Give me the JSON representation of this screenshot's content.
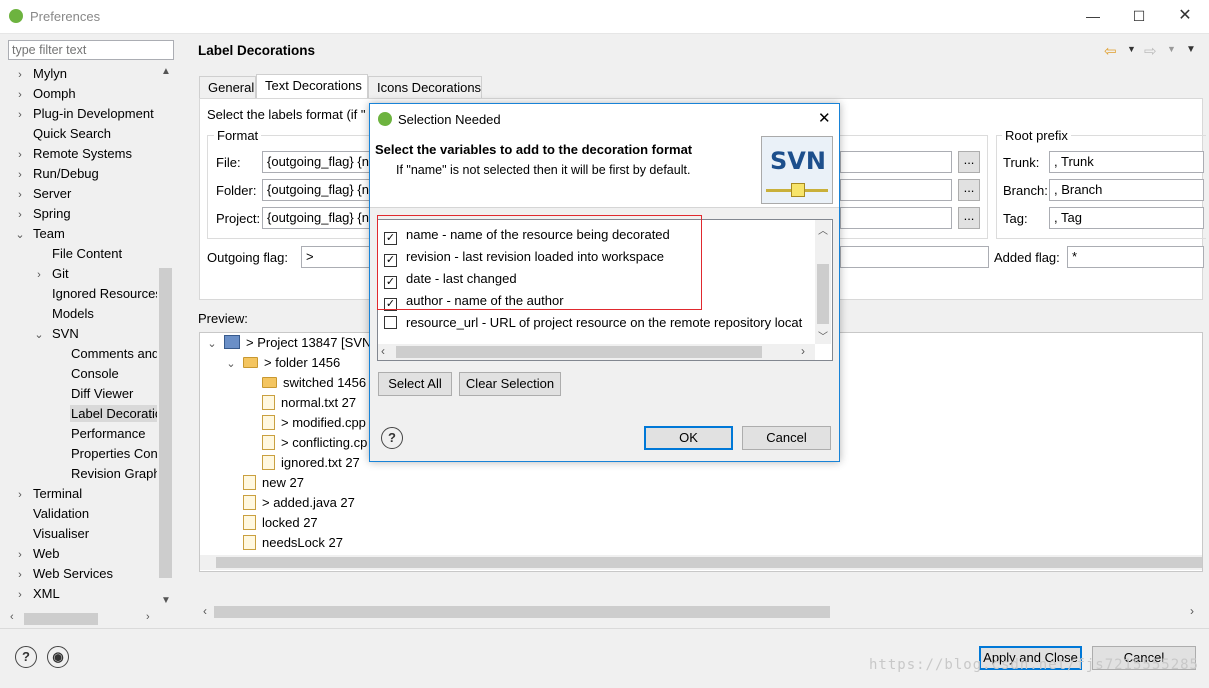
{
  "window": {
    "title": "Preferences",
    "controls": [
      "minimize",
      "maximize",
      "close"
    ]
  },
  "filter": {
    "placeholder": "type filter text"
  },
  "tree": [
    {
      "label": "Mylyn",
      "level": 0,
      "chev": "›"
    },
    {
      "label": "Oomph",
      "level": 0,
      "chev": "›"
    },
    {
      "label": "Plug-in Development",
      "level": 0,
      "chev": "›"
    },
    {
      "label": "Quick Search",
      "level": 0,
      "chev": ""
    },
    {
      "label": "Remote Systems",
      "level": 0,
      "chev": "›"
    },
    {
      "label": "Run/Debug",
      "level": 0,
      "chev": "›"
    },
    {
      "label": "Server",
      "level": 0,
      "chev": "›"
    },
    {
      "label": "Spring",
      "level": 0,
      "chev": "›"
    },
    {
      "label": "Team",
      "level": 0,
      "chev": "⌄"
    },
    {
      "label": "File Content",
      "level": 1,
      "chev": ""
    },
    {
      "label": "Git",
      "level": 1,
      "chev": "›"
    },
    {
      "label": "Ignored Resources",
      "level": 1,
      "chev": ""
    },
    {
      "label": "Models",
      "level": 1,
      "chev": ""
    },
    {
      "label": "SVN",
      "level": 1,
      "chev": "⌄"
    },
    {
      "label": "Comments and",
      "level": 2,
      "chev": ""
    },
    {
      "label": "Console",
      "level": 2,
      "chev": ""
    },
    {
      "label": "Diff Viewer",
      "level": 2,
      "chev": ""
    },
    {
      "label": "Label Decoratio",
      "level": 2,
      "chev": "",
      "selected": true
    },
    {
      "label": "Performance",
      "level": 2,
      "chev": ""
    },
    {
      "label": "Properties Con",
      "level": 2,
      "chev": ""
    },
    {
      "label": "Revision Graph",
      "level": 2,
      "chev": ""
    },
    {
      "label": "Terminal",
      "level": 0,
      "chev": "›"
    },
    {
      "label": "Validation",
      "level": 0,
      "chev": ""
    },
    {
      "label": "Visualiser",
      "level": 0,
      "chev": ""
    },
    {
      "label": "Web",
      "level": 0,
      "chev": "›"
    },
    {
      "label": "Web Services",
      "level": 0,
      "chev": "›"
    },
    {
      "label": "XML",
      "level": 0,
      "chev": "›"
    }
  ],
  "page": {
    "title": "Label Decorations"
  },
  "tabs": [
    "General",
    "Text Decorations",
    "Icons Decorations"
  ],
  "text_decorations": {
    "intro": "Select the labels format (if \"",
    "format_group": "Format",
    "file_label": "File:",
    "file_value": "{outgoing_flag} {n",
    "folder_label": "Folder:",
    "folder_value": "{outgoing_flag} {n",
    "project_label": "Project:",
    "project_value": "{outgoing_flag} {n",
    "dots": "...",
    "root_prefix_group": "Root prefix",
    "trunk_label": "Trunk:",
    "trunk_value": ", Trunk",
    "branch_label": "Branch:",
    "branch_value": ", Branch",
    "tag_label": "Tag:",
    "tag_value": ", Tag",
    "outgoing_label": "Outgoing flag:",
    "outgoing_value": ">",
    "added_label": "Added flag:",
    "added_value": "*"
  },
  "preview": {
    "label": "Preview:",
    "items": [
      {
        "text": "> Project 13847 [SVN",
        "icon": "project",
        "chev": "⌄",
        "indent": 0
      },
      {
        "text": "> folder 1456",
        "icon": "folder",
        "chev": "⌄",
        "indent": 1
      },
      {
        "text": "switched 1456",
        "icon": "folder",
        "chev": "",
        "indent": 2
      },
      {
        "text": "normal.txt 27",
        "icon": "file",
        "chev": "",
        "indent": 2
      },
      {
        "text": "> modified.cpp",
        "icon": "file",
        "chev": "",
        "indent": 2
      },
      {
        "text": "> conflicting.cp",
        "icon": "file",
        "chev": "",
        "indent": 2
      },
      {
        "text": "ignored.txt 27",
        "icon": "file",
        "chev": "",
        "indent": 2
      },
      {
        "text": "new 27",
        "icon": "file",
        "chev": "",
        "indent": 1
      },
      {
        "text": "> added.java 27",
        "icon": "file",
        "chev": "",
        "indent": 1
      },
      {
        "text": "locked 27",
        "icon": "file",
        "chev": "",
        "indent": 1
      },
      {
        "text": "needsLock 27",
        "icon": "file",
        "chev": "",
        "indent": 1
      }
    ]
  },
  "footer": {
    "apply_close": "Apply and Close",
    "cancel": "Cancel",
    "watermark": "https://blog.csdn.net/fjs7215555285"
  },
  "dialog": {
    "title": "Selection Needed",
    "heading": "Select the variables to add to the decoration format",
    "subtext": "If \"name\" is not selected then it will be first by default.",
    "logo_text": "SVN",
    "items": [
      {
        "text": "name - name of the resource being decorated",
        "checked": true
      },
      {
        "text": "revision - last revision loaded into workspace",
        "checked": true
      },
      {
        "text": "date - last changed",
        "checked": true
      },
      {
        "text": "author - name of the author",
        "checked": true
      },
      {
        "text": "resource_url - URL of project resource on the remote repository locat",
        "checked": false
      }
    ],
    "select_all": "Select All",
    "clear_selection": "Clear Selection",
    "ok": "OK",
    "cancel": "Cancel",
    "highlight_color": "#e0292e",
    "accent_color": "#0078d7"
  }
}
